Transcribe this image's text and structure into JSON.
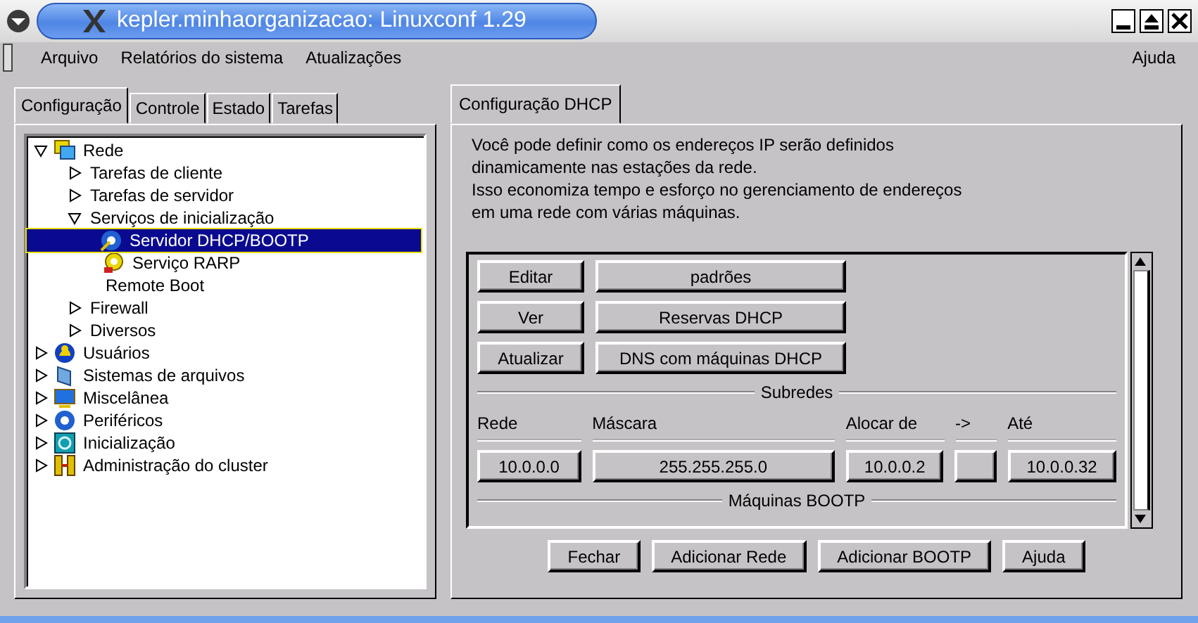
{
  "window": {
    "title": "kepler.minhaorganizacao: Linuxconf 1.29"
  },
  "menu": {
    "items": [
      "Arquivo",
      "Relatórios do sistema",
      "Atualizações"
    ],
    "help": "Ajuda"
  },
  "left_tabs": [
    {
      "label": "Configuração",
      "selected": true
    },
    {
      "label": "Controle",
      "selected": false
    },
    {
      "label": "Estado",
      "selected": false
    },
    {
      "label": "Tarefas",
      "selected": false
    }
  ],
  "tree": [
    {
      "label": "Rede",
      "expanded": true,
      "selected": false,
      "children": [
        {
          "label": "Tarefas de cliente",
          "expanded": false,
          "selected": false
        },
        {
          "label": "Tarefas de servidor",
          "expanded": false,
          "selected": false
        },
        {
          "label": "Serviços de inicialização",
          "expanded": true,
          "selected": false,
          "children": [
            {
              "label": "Servidor DHCP/BOOTP",
              "selected": true
            },
            {
              "label": "Serviço RARP",
              "selected": false
            },
            {
              "label": "Remote Boot",
              "selected": false
            }
          ]
        },
        {
          "label": "Firewall",
          "expanded": false,
          "selected": false
        },
        {
          "label": "Diversos",
          "expanded": false,
          "selected": false
        }
      ]
    },
    {
      "label": "Usuários",
      "expanded": false,
      "selected": false
    },
    {
      "label": "Sistemas de arquivos",
      "expanded": false,
      "selected": false
    },
    {
      "label": "Miscelânea",
      "expanded": false,
      "selected": false
    },
    {
      "label": "Periféricos",
      "expanded": false,
      "selected": false
    },
    {
      "label": "Inicialização",
      "expanded": false,
      "selected": false
    },
    {
      "label": "Administração do cluster",
      "expanded": false,
      "selected": false
    }
  ],
  "right_tab": {
    "label": "Configuração DHCP",
    "selected": true
  },
  "description_lines": [
    "Você pode definir como os endereços IP serão definidos",
    "dinamicamente nas estações da rede.",
    "Isso economiza tempo e esforço no gerenciamento de endereços",
    "em uma rede com várias máquinas."
  ],
  "actions": [
    {
      "button": "Editar",
      "option": "padrões"
    },
    {
      "button": "Ver",
      "option": "Reservas DHCP"
    },
    {
      "button": "Atualizar",
      "option": "DNS com máquinas DHCP"
    }
  ],
  "subnets": {
    "title": "Subredes",
    "columns": [
      "Rede",
      "Máscara",
      "Alocar de",
      "->",
      "Até"
    ],
    "rows": [
      [
        "10.0.0.0",
        "255.255.255.0",
        "10.0.0.2",
        "",
        "10.0.0.32"
      ]
    ]
  },
  "bootp": {
    "title": "Máquinas BOOTP"
  },
  "buttons": [
    "Fechar",
    "Adicionar Rede",
    "Adicionar BOOTP",
    "Ajuda"
  ]
}
